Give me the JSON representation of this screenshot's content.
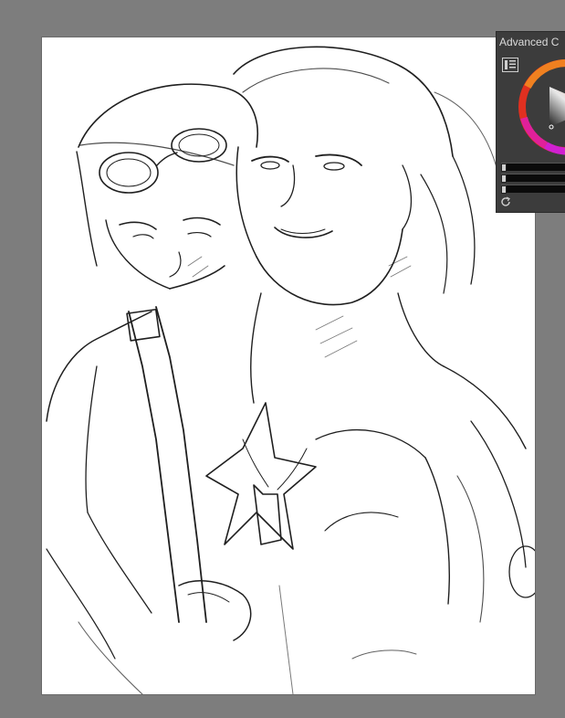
{
  "panel": {
    "title": "Advanced C",
    "icons": {
      "menu": "panel-menu-icon",
      "wheel": "color-wheel",
      "refresh": "refresh-icon"
    },
    "sliders": [
      "slider-1",
      "slider-2",
      "slider-3"
    ]
  },
  "colors": {
    "workspace": "#7d7d7d",
    "canvas": "#ffffff",
    "panel": "#3c3c3c",
    "sketch_line": "#1a1a1a"
  }
}
